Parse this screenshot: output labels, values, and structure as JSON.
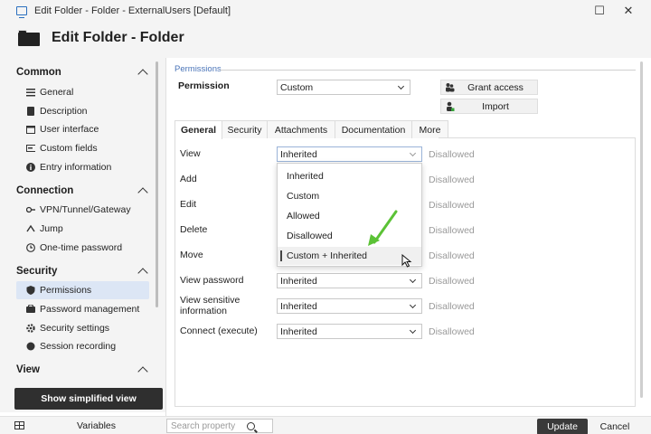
{
  "window": {
    "title": "Edit Folder - Folder - ExternalUsers [Default]",
    "maximize_glyph": "☐",
    "close_glyph": "✕"
  },
  "header": {
    "title": "Edit Folder - Folder"
  },
  "sidebar": {
    "sections": [
      {
        "name": "Common",
        "items": [
          {
            "label": "General",
            "icon": "list-icon"
          },
          {
            "label": "Description",
            "icon": "description-icon"
          },
          {
            "label": "User interface",
            "icon": "window-icon"
          },
          {
            "label": "Custom fields",
            "icon": "tag-icon"
          },
          {
            "label": "Entry information",
            "icon": "info-icon"
          }
        ]
      },
      {
        "name": "Connection",
        "items": [
          {
            "label": "VPN/Tunnel/Gateway",
            "icon": "vpn-icon"
          },
          {
            "label": "Jump",
            "icon": "jump-icon"
          },
          {
            "label": "One-time password",
            "icon": "clock-icon"
          }
        ]
      },
      {
        "name": "Security",
        "items": [
          {
            "label": "Permissions",
            "icon": "shield-icon",
            "active": true
          },
          {
            "label": "Password management",
            "icon": "key-icon"
          },
          {
            "label": "Security settings",
            "icon": "gear-icon"
          },
          {
            "label": "Session recording",
            "icon": "record-icon"
          }
        ]
      },
      {
        "name": "View",
        "items": []
      }
    ],
    "simplified_button": "Show simplified view"
  },
  "main": {
    "section_caption": "Permissions",
    "permission_label": "Permission",
    "permission_value": "Custom",
    "grant_access": "Grant access",
    "import": "Import",
    "tabs": [
      "General",
      "Security",
      "Attachments",
      "Documentation",
      "More"
    ],
    "active_tab": "General",
    "rows": [
      {
        "label": "View",
        "value": "Inherited",
        "state": "Disallowed"
      },
      {
        "label": "Add",
        "value": "",
        "state": "Disallowed"
      },
      {
        "label": "Edit",
        "value": "",
        "state": "Disallowed"
      },
      {
        "label": "Delete",
        "value": "",
        "state": "Disallowed"
      },
      {
        "label": "Move",
        "value": "",
        "state": "Disallowed"
      },
      {
        "label": "View password",
        "value": "Inherited",
        "state": "Disallowed"
      },
      {
        "label": "View sensitive information",
        "value": "Inherited",
        "state": "Disallowed"
      },
      {
        "label": "Connect (execute)",
        "value": "Inherited",
        "state": "Disallowed"
      }
    ],
    "dropdown_options": [
      "Inherited",
      "Custom",
      "Allowed",
      "Disallowed",
      "Custom + Inherited"
    ],
    "dropdown_hover": "Custom + Inherited"
  },
  "footer": {
    "variables": "Variables",
    "search_placeholder": "Search property",
    "update": "Update",
    "cancel": "Cancel"
  },
  "colors": {
    "accent": "#4a74b8",
    "active_nav": "#dce6f5",
    "annotation_arrow": "#5bc236"
  }
}
